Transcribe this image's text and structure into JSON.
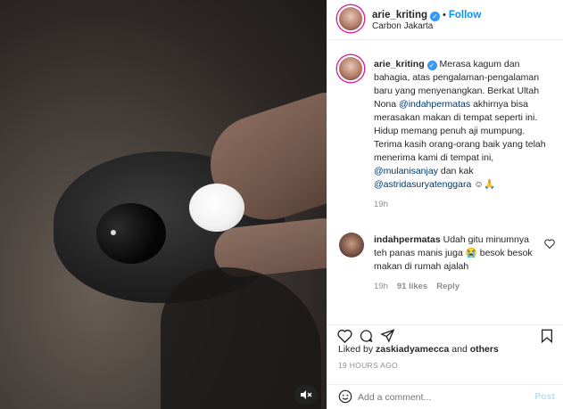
{
  "post": {
    "username": "arie_kriting",
    "follow_label": "Follow",
    "separator": "•",
    "location": "Carbon Jakarta",
    "more_label": "···"
  },
  "caption": {
    "username": "arie_kriting",
    "text_1": "Merasa kagum dan bahagia, atas pengalaman-pengalaman baru yang menyenangkan. Berkat Ultah Nona ",
    "mention_1": "@indahpermatas",
    "text_2": " akhirnya bisa merasakan makan di tempat seperti ini. Hidup memang penuh aji mumpung. Terima kasih orang-orang baik yang telah menerima kami di tempat ini, ",
    "mention_2": "@mulanisanjay",
    "text_3": " dan kak ",
    "mention_3": "@astridasuryatenggara",
    "text_4": " ☺🙏",
    "time": "19h"
  },
  "reply": {
    "username": "indahpermatas",
    "text": " Udah gitu minumnya teh panas manis juga 😭 besok besok makan di rumah ajalah",
    "time": "19h",
    "likes": "91 likes",
    "reply_label": "Reply"
  },
  "actions": {
    "liked_by_prefix": "Liked by ",
    "liked_by_user": "zaskiadyamecca",
    "liked_by_suffix": " and ",
    "liked_by_others": "others",
    "timestamp": "19 HOURS AGO"
  },
  "composer": {
    "placeholder": "Add a comment...",
    "post_label": "Post"
  },
  "icons": {
    "verified": "✓",
    "mute": "🔇"
  },
  "colors": {
    "accent": "#0095f6",
    "verified": "#3897f0",
    "post_disabled": "#b2dffc",
    "muted_text": "#8e8e8e"
  }
}
